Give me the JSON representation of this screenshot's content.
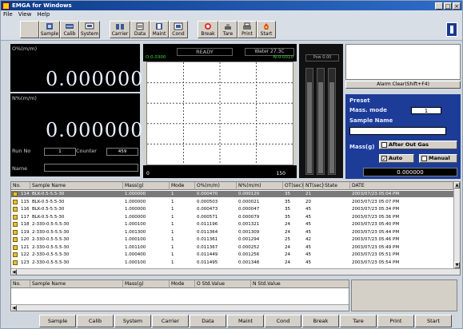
{
  "window": {
    "title": "EMGA for Windows"
  },
  "menu": [
    "File",
    "View",
    "Help"
  ],
  "toolbar": [
    {
      "label": "Sample",
      "icon": "sample-icon"
    },
    {
      "label": "Calib",
      "icon": "calib-icon"
    },
    {
      "label": "System",
      "icon": "system-icon"
    },
    {
      "label": "Carrier",
      "icon": "carrier-icon"
    },
    {
      "label": "Data",
      "icon": "data-icon"
    },
    {
      "label": "Maint",
      "icon": "maint-icon"
    },
    {
      "label": "Cond",
      "icon": "cond-icon"
    },
    {
      "label": "Break",
      "icon": "break-icon"
    },
    {
      "label": "Tare",
      "icon": "tare-icon"
    },
    {
      "label": "Print",
      "icon": "print-icon"
    },
    {
      "label": "Start",
      "icon": "start-icon"
    }
  ],
  "readout": {
    "o_label": "O%(m/m)",
    "o_value": "0.000000",
    "n_label": "N%(m/m)",
    "n_value": "0.000000",
    "run_no_label": "Run No",
    "run_no": "1",
    "counter_label": "Counter",
    "counter": "459",
    "name_label": "Name"
  },
  "monitor": {
    "status": "READY",
    "water": "Water 27.3C",
    "o_range": "O:0.0300",
    "n_range": "N:0.0010",
    "x_min": "0",
    "x_max": "150",
    "power_label": "Pow 0.00"
  },
  "chart_data": {
    "type": "line",
    "x": [],
    "series": [],
    "xlim": [
      0,
      150
    ],
    "grid": true
  },
  "power_bars": [
    0.86,
    0.86,
    0.86
  ],
  "alarm_clear": "Alarm Clear(Shift+F4)",
  "preset": {
    "preset_label": "Preset",
    "mass_mode_label": "Mass. mode",
    "mass_mode": "1",
    "sample_name_label": "Sample Name",
    "mass_label": "Mass(g)",
    "after_out_gas": "After Out Gas",
    "auto": "Auto",
    "auto_checked": true,
    "manual": "Manual",
    "manual_checked": false,
    "mass_value": "0.000000"
  },
  "results_table": {
    "headers": [
      "No.",
      "Sample Name",
      "Mass(g)",
      "Mode",
      "O%(m/m)",
      "N%(m/m)",
      "OT(sec)",
      "NT(sec)",
      "State",
      "DATE"
    ],
    "rows": [
      [
        "114",
        "BLK-0.5-5.5-30",
        "1.000000",
        "1",
        "0.000470",
        "0.000120",
        "35",
        "21",
        "",
        "2003/07/23 05:04 PM"
      ],
      [
        "115",
        "BLK-0.5-5.5-30",
        "1.000000",
        "1",
        "0.000503",
        "0.000021",
        "35",
        "20",
        "",
        "2003/07/23 05:07 PM"
      ],
      [
        "116",
        "BLK-0.5-5.5-30",
        "1.000000",
        "1",
        "0.000473",
        "0.000047",
        "35",
        "45",
        "",
        "2003/07/23 05:34 PM"
      ],
      [
        "117",
        "BLK-0.5-5.5-30",
        "1.000000",
        "1",
        "0.000571",
        "0.000079",
        "35",
        "45",
        "",
        "2003/07/23 05:36 PM"
      ],
      [
        "118",
        "2-330-0.5-5.5-30",
        "1.000100",
        "1",
        "0.011196",
        "0.001321",
        "24",
        "45",
        "",
        "2003/07/23 05:40 PM"
      ],
      [
        "119",
        "2-330-0.5-5.5-30",
        "1.001300",
        "1",
        "0.011364",
        "0.001309",
        "24",
        "45",
        "",
        "2003/07/23 05:44 PM"
      ],
      [
        "120",
        "2-330-0.5-5.5-30",
        "1.000100",
        "1",
        "0.011361",
        "0.001294",
        "25",
        "42",
        "",
        "2003/07/23 05:46 PM"
      ],
      [
        "121",
        "2-330-0.5-5.5-30",
        "1.001100",
        "1",
        "0.011367",
        "0.000252",
        "24",
        "45",
        "",
        "2003/07/23 05:49 PM"
      ],
      [
        "122",
        "2-330-0.5-5.5-30",
        "1.000400",
        "1",
        "0.011449",
        "0.001256",
        "24",
        "45",
        "",
        "2003/07/23 05:51 PM"
      ],
      [
        "123",
        "2-330-0.5-5.5-30",
        "1.000100",
        "1",
        "0.011495",
        "0.001348",
        "24",
        "45",
        "",
        "2003/07/23 05:54 PM"
      ]
    ]
  },
  "std_table": {
    "headers": [
      "No.",
      "Sample Name",
      "Mass(g)",
      "Mode",
      "O Std.Value",
      "N Std.Value"
    ]
  },
  "bottom_buttons": [
    "Sample",
    "Calib",
    "System",
    "Carrier",
    "Data",
    "Maint",
    "Cond",
    "Break",
    "Tare",
    "Print",
    "Start"
  ]
}
